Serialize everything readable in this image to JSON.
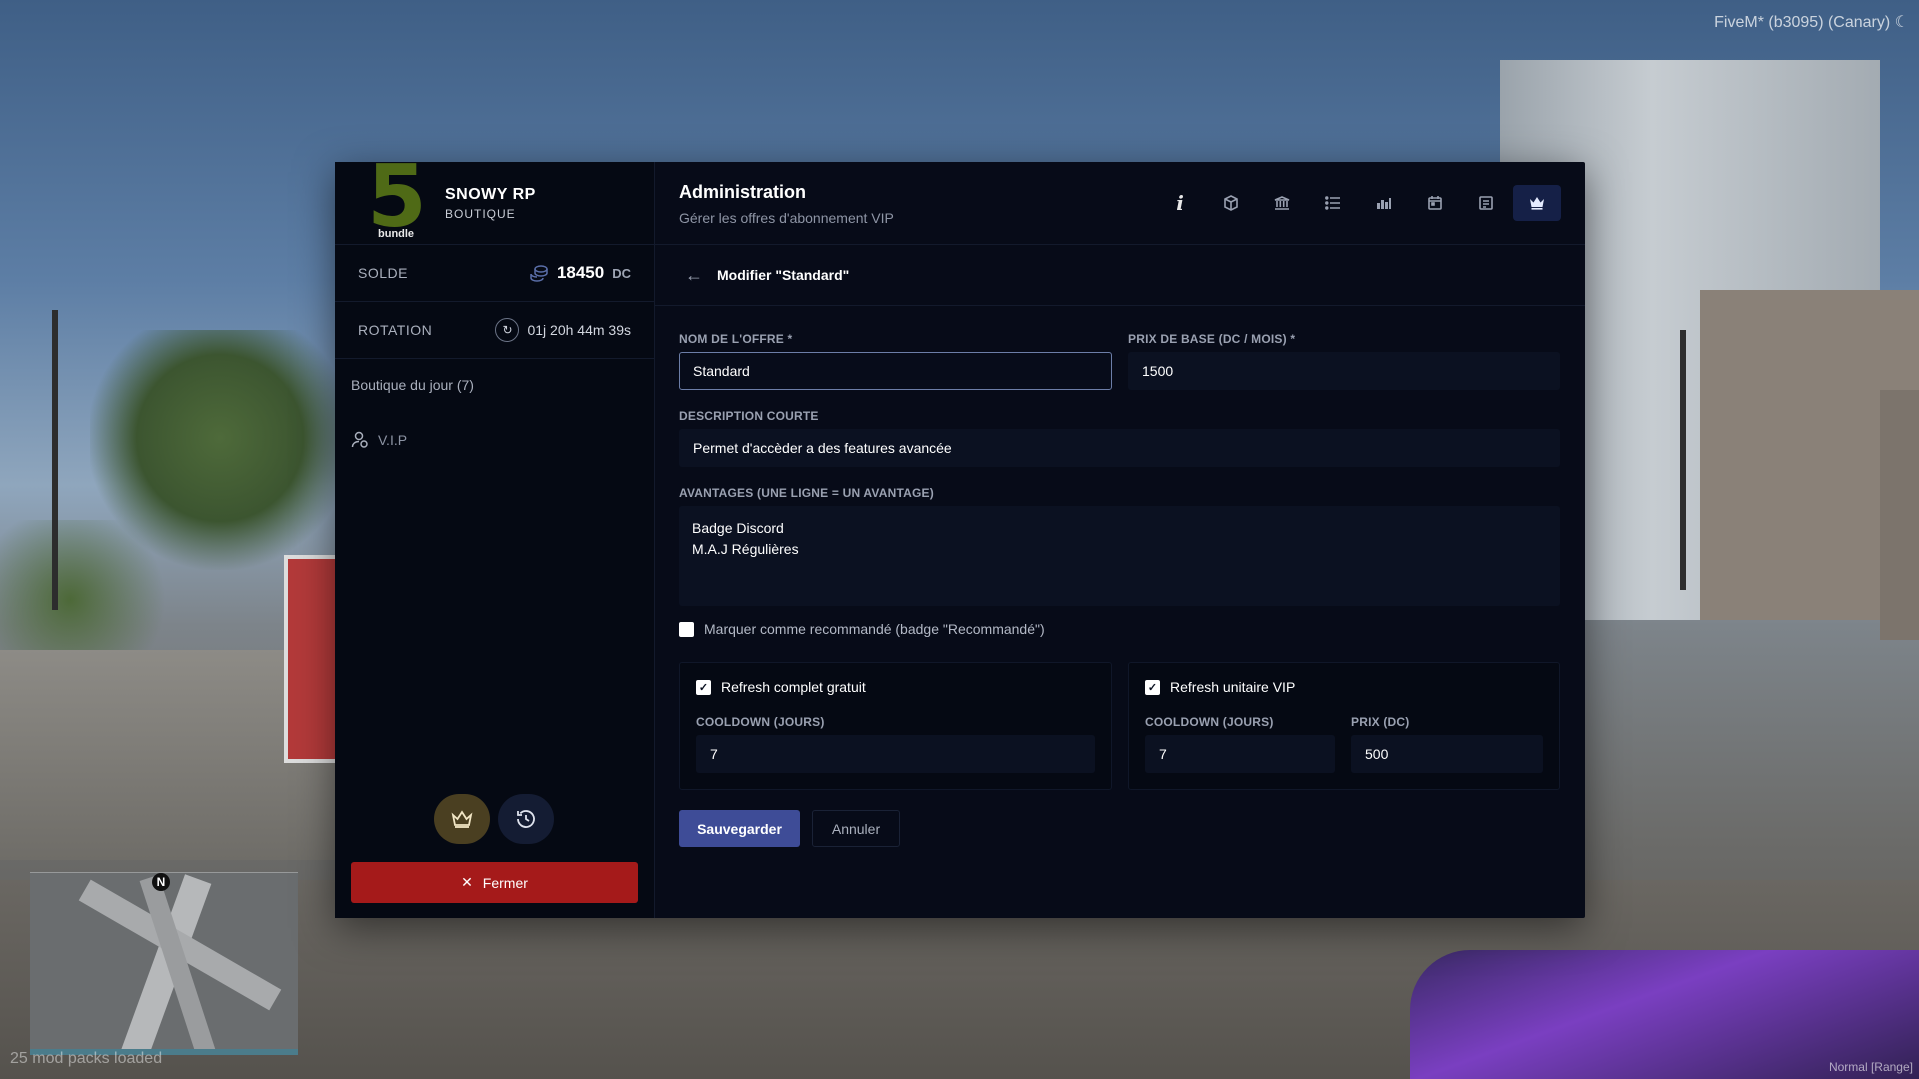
{
  "overlay": {
    "fivem_title": "FiveM* (b3095) (Canary) ☾",
    "mod_packs": "25 mod packs loaded",
    "range_mode": "Normal [Range]",
    "minimap_north": "N"
  },
  "sidebar": {
    "logo_digit": "5",
    "logo_word": "bundle",
    "brand_name": "SNOWY RP",
    "brand_sub": "BOUTIQUE",
    "balance_label": "SOLDE",
    "balance_value": "18450",
    "balance_unit": "DC",
    "rotation_label": "ROTATION",
    "rotation_value": "01j 20h 44m 39s",
    "daily_shop": "Boutique du jour (7)",
    "vip_item": "V.I.P",
    "close_label": "Fermer"
  },
  "header": {
    "title": "Administration",
    "subtitle": "Gérer les offres d'abonnement VIP"
  },
  "edit": {
    "title": "Modifier \"Standard\"",
    "offer_name_label": "NOM DE L'OFFRE *",
    "offer_name_value": "Standard",
    "base_price_label": "PRIX DE BASE (DC / MOIS) *",
    "base_price_value": "1500",
    "short_desc_label": "DESCRIPTION COURTE",
    "short_desc_value": "Permet d'accèder a des features avancée",
    "advantages_label": "AVANTAGES (UNE LIGNE = UN AVANTAGE)",
    "advantages": [
      "Badge Discord",
      "M.A.J Régulières"
    ],
    "recommended_label": "Marquer comme recommandé (badge \"Recommandé\")",
    "recommended_checked": false,
    "refresh_full": {
      "label": "Refresh complet gratuit",
      "checked": true,
      "cooldown_label": "COOLDOWN (JOURS)",
      "cooldown_value": "7"
    },
    "refresh_unit": {
      "label": "Refresh unitaire VIP",
      "checked": true,
      "cooldown_label": "COOLDOWN (JOURS)",
      "cooldown_value": "7",
      "price_label": "PRIX (DC)",
      "price_value": "500"
    },
    "save_label": "Sauvegarder",
    "cancel_label": "Annuler"
  },
  "toolbar_icons": [
    "info-icon",
    "box-icon",
    "bank-icon",
    "list-icon",
    "chart-icon",
    "calendar-icon",
    "log-icon",
    "crown-icon"
  ],
  "colors": {
    "accent": "#3e4c97",
    "danger": "#a51a1a",
    "panel": "#070b18",
    "logo_green": "#4f6a16"
  }
}
